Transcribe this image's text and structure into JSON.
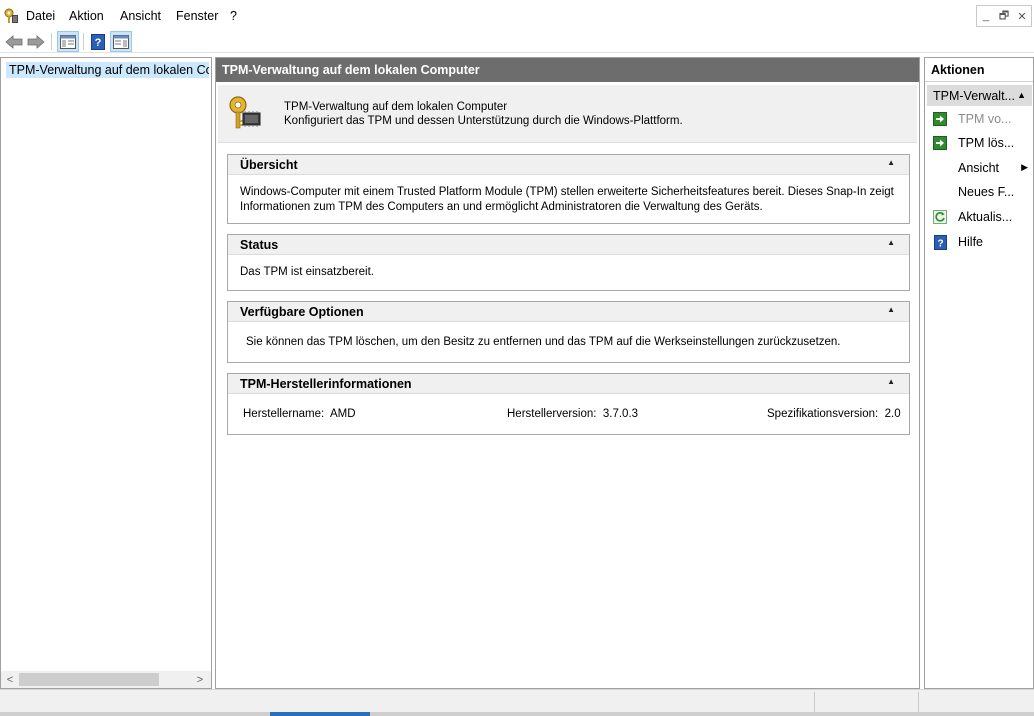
{
  "menubar": {
    "items": [
      "Datei",
      "Aktion",
      "Ansicht",
      "Fenster",
      "?"
    ],
    "window_buttons": {
      "minimize": "_",
      "restore": "🗗",
      "close": "✕"
    }
  },
  "toolbar": {
    "buttons": [
      "back-icon",
      "forward-icon",
      "show-hide-console-tree-icon",
      "help-icon",
      "show-hide-action-pane-icon"
    ]
  },
  "tree": {
    "root_label": "TPM-Verwaltung auf dem lokalen Computer"
  },
  "middle": {
    "header": "TPM-Verwaltung auf dem lokalen Computer",
    "intro_title": "TPM-Verwaltung auf dem lokalen Computer",
    "intro_desc": "Konfiguriert das TPM und dessen Unterstützung durch die Windows-Plattform.",
    "sections": {
      "overview": {
        "title": "Übersicht",
        "line1": "Windows-Computer mit einem Trusted Platform Module (TPM) stellen erweiterte Sicherheitsfeatures bereit. Dieses Snap-In zeigt",
        "line2": "Informationen zum TPM des Computers an und ermöglicht Administratoren die Verwaltung des Geräts."
      },
      "status": {
        "title": "Status",
        "text": "Das TPM ist einsatzbereit."
      },
      "options": {
        "title": "Verfügbare Optionen",
        "text": "Sie können das TPM löschen, um den Besitz zu entfernen und das TPM auf die Werkseinstellungen zurückzusetzen."
      },
      "manufacturer": {
        "title": "TPM-Herstellerinformationen",
        "name_label": "Herstellername:",
        "name_value": "AMD",
        "version_label": "Herstellerversion:",
        "version_value": "3.7.0.3",
        "spec_label": "Spezifikationsversion:",
        "spec_value": "2.0"
      }
    }
  },
  "actions": {
    "title": "Aktionen",
    "group": "TPM-Verwalt...",
    "items": [
      {
        "label": "TPM vo...",
        "icon": "green-arrow-icon",
        "disabled": true
      },
      {
        "label": "TPM lös...",
        "icon": "green-arrow-icon",
        "disabled": false
      },
      {
        "label": "Ansicht",
        "icon": "",
        "disabled": false,
        "submenu": true
      },
      {
        "label": "Neues F...",
        "icon": "",
        "disabled": false
      },
      {
        "label": "Aktualis...",
        "icon": "refresh-icon",
        "disabled": false
      },
      {
        "label": "Hilfe",
        "icon": "help-icon",
        "disabled": false
      }
    ]
  },
  "colors": {
    "header_bg": "#6d6d6d",
    "selection_bg": "#cce8ff",
    "action_green": "#2e8b2e",
    "help_blue": "#2b5fb5"
  }
}
